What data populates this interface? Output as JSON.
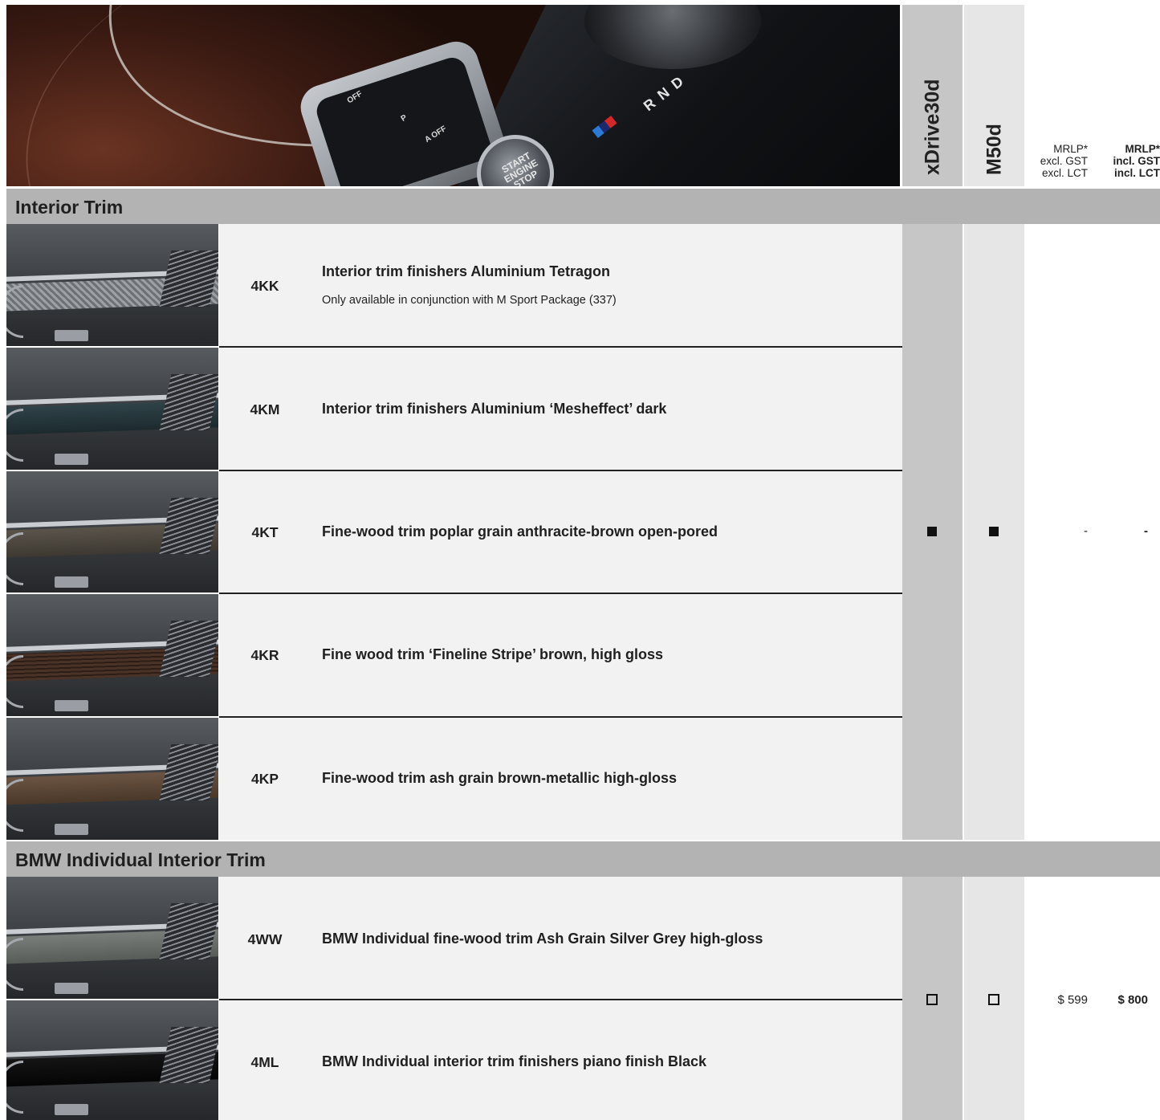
{
  "header": {
    "col1": "xDrive30d",
    "col2": "M50d",
    "price_excl": {
      "line1": "MRLP*",
      "line2": "excl. GST",
      "line3": "excl. LCT"
    },
    "price_incl": {
      "line1": "MRLP*",
      "line2": "incl. GST",
      "line3": "incl. LCT"
    }
  },
  "hero": {
    "btn_off1": "OFF",
    "btn_p": "P",
    "btn_aoff": "A OFF",
    "start": "START ENGINE STOP",
    "gear": "R N D"
  },
  "sections": [
    {
      "title": "Interior Trim",
      "rows": [
        {
          "code": "4KK",
          "desc": "Interior trim finishers Aluminium Tetragon",
          "note": "Only available in conjunction with M Sport Package (337)"
        },
        {
          "code": "4KM",
          "desc": "Interior trim finishers Aluminium ‘Mesheffect’ dark"
        },
        {
          "code": "4KT",
          "desc": "Fine-wood trim poplar grain anthracite-brown open-pored"
        },
        {
          "code": "4KR",
          "desc": "Fine wood trim ‘Fineline Stripe’ brown, high gloss"
        },
        {
          "code": "4KP",
          "desc": "Fine-wood trim ash grain brown-metallic high-gloss"
        }
      ],
      "availability": {
        "xdrive30d": "standard",
        "m50d": "standard"
      },
      "price_excl": "-",
      "price_incl": "-"
    },
    {
      "title": "BMW Individual Interior Trim",
      "rows": [
        {
          "code": "4WW",
          "desc": "BMW Individual fine-wood trim Ash Grain Silver Grey high-gloss"
        },
        {
          "code": "4ML",
          "desc": "BMW Individual interior trim finishers piano finish Black"
        }
      ],
      "availability": {
        "xdrive30d": "option",
        "m50d": "option"
      },
      "price_excl": "$ 599",
      "price_incl": "$ 800"
    }
  ],
  "colors": {
    "section_bar": "#b3b3b3",
    "col1_bg": "#c6c6c6",
    "col2_bg": "#e6e6e6",
    "row_bg": "#f2f2f2"
  }
}
